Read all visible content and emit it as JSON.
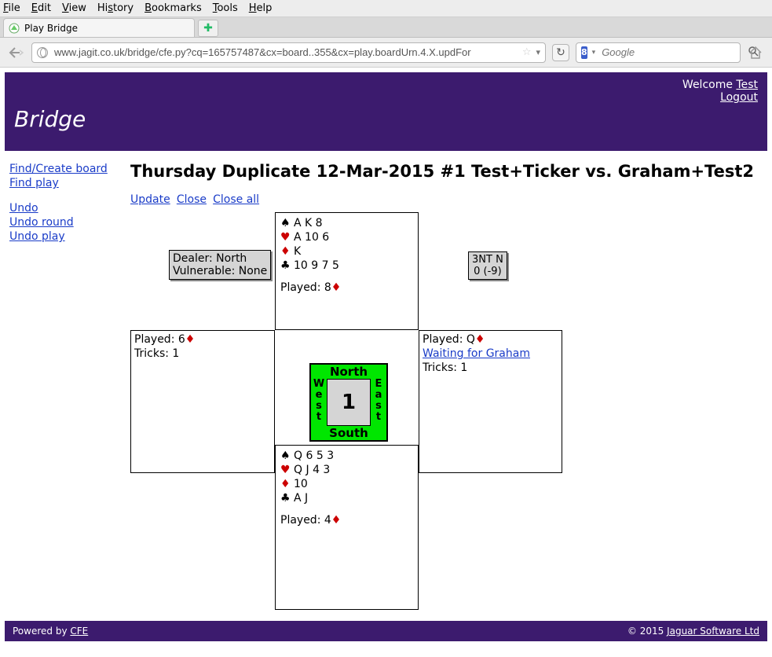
{
  "browser": {
    "menus": [
      "File",
      "Edit",
      "View",
      "History",
      "Bookmarks",
      "Tools",
      "Help"
    ],
    "tab_title": "Play Bridge",
    "url": "www.jagit.co.uk/bridge/cfe.py?cq=165757487&cx=board..355&cx=play.boardUrn.4.X.updFor",
    "search_placeholder": "Google",
    "search_engine_badge": "8"
  },
  "header": {
    "brand": "Bridge",
    "welcome_prefix": "Welcome ",
    "user_link": "Test",
    "logout": "Logout"
  },
  "sidebar": {
    "find_board": "Find/Create board",
    "find_play": "Find play",
    "undo": "Undo",
    "undo_round": "Undo round",
    "undo_play": "Undo play"
  },
  "main": {
    "title": "Thursday Duplicate 12-Mar-2015 #1 Test+Ticker vs. Graham+Test2",
    "action_update": "Update",
    "action_close": "Close",
    "action_close_all": "Close all"
  },
  "dealer_box": {
    "dealer": "Dealer: North",
    "vuln": "Vulnerable: None"
  },
  "contract_box": {
    "line1": "3NT N",
    "line2": "0 (-9)"
  },
  "compass": {
    "n": "North",
    "s": "South",
    "w": "West",
    "e": "East",
    "board_no": "1"
  },
  "hands": {
    "north": {
      "spades": "A K 8",
      "hearts": "A 10 6",
      "diamonds": "K",
      "clubs": "10 9 7 5",
      "played_prefix": "Played: 8"
    },
    "south": {
      "spades": "Q 6 5 3",
      "hearts": "Q J 4 3",
      "diamonds": "10",
      "clubs": "A J",
      "played_prefix": "Played: 4"
    },
    "west": {
      "played_prefix": "Played: 6",
      "tricks": "Tricks: 1"
    },
    "east": {
      "played_prefix": "Played: Q",
      "waiting": "Waiting for Graham",
      "tricks": "Tricks: 1"
    }
  },
  "footer": {
    "powered_prefix": "Powered by ",
    "powered_link": "CFE",
    "copyright_prefix": "© 2015 ",
    "copyright_link": "Jaguar Software Ltd"
  }
}
